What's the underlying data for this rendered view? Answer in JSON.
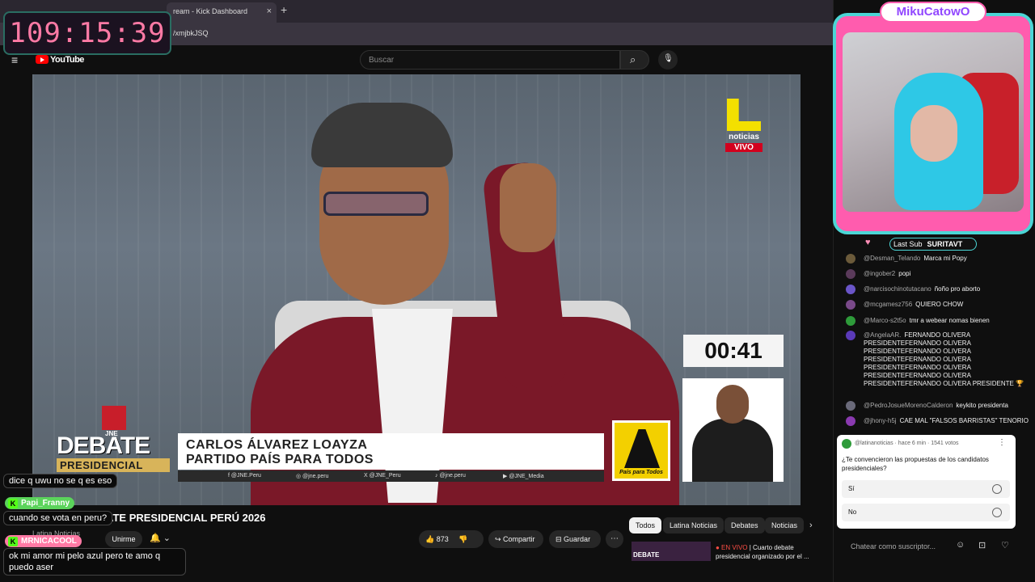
{
  "browser": {
    "tab_title": "ream - Kick Dashboard",
    "tab_close": "×",
    "new_tab": "+",
    "url": "/xmjbkJSQ"
  },
  "stream_timer": "109:15:39",
  "youtube": {
    "menu_icon": "≡",
    "logo_text": "YouTube",
    "search_placeholder": "Buscar",
    "search_icon": "⌕",
    "mic_icon": "🎙"
  },
  "video": {
    "broadcaster_word": "noticias",
    "live_badge": "VIVO",
    "countdown": "00:41",
    "jne_label": "JNE",
    "debate_word": "DEBATE",
    "debate_sub": "PRESIDENCIAL",
    "candidate_name": "CARLOS ÁLVAREZ LOAYZA",
    "party_name": "PARTIDO PAÍS PARA TODOS",
    "party_logo_text": "País para Todos",
    "socials": [
      "f  @JNE.Peru",
      "◎  @jne.peru",
      "X  @JNE_Peru",
      "♪  @jne.peru",
      "▶  @JNE_Media"
    ],
    "fullscreen_icon": "⛶"
  },
  "below_video": {
    "title": "EN VIVO | DEBATE PRESIDENCIAL PERÚ 2026",
    "channel": "Latina Noticias",
    "subscribe": "Unirme",
    "bell_icon": "🔔 ⌄",
    "likes": "873",
    "share": "Compartir",
    "save": "Guardar",
    "more": "⋯"
  },
  "chips": [
    "Todos",
    "Latina Noticias",
    "Debates",
    "Noticias"
  ],
  "chip_next": "›",
  "recommendation": {
    "thumb_text": "DEBATE",
    "live_label": "● EN VIVO",
    "title": "| Cuarto debate presidencial organizado por el ..."
  },
  "overlay_chat": [
    {
      "text": "dice q uwu no se q es eso"
    },
    {
      "user": "Papi_Franny"
    },
    {
      "text": "cuando se vota en peru?"
    },
    {
      "user": "MRNICACOOL"
    },
    {
      "text": "ok mi amor mi pelo azul pero te amo q puedo aser"
    }
  ],
  "streamer": {
    "name": "MikuCatowO",
    "last_sub_label": "Last Sub",
    "last_sub_name": "SURITAVT",
    "heart_icon": "♥"
  },
  "chat": [
    {
      "user": "@Desman_Telando",
      "msg": "Marca mi Popy",
      "color": "#6b5a3a"
    },
    {
      "user": "@ingober2",
      "msg": "popi",
      "color": "#5a3a5a"
    },
    {
      "user": "@narcisochinotutacano",
      "msg": "ñoño pro aborto",
      "color": "#6a55c8"
    },
    {
      "user": "@mcgamesz756",
      "msg": "QUIERO CHOW",
      "color": "#7a4a8a"
    },
    {
      "user": "@Marco-s2t5o",
      "msg": "tmr a webear nomas bienen",
      "color": "#2e9b3a"
    },
    {
      "user": "@AngelaAR.",
      "msg": "FERNANDO OLIVERA PRESIDENTEFERNANDO OLIVERA PRESIDENTEFERNANDO OLIVERA PRESIDENTEFERNANDO OLIVERA PRESIDENTEFERNANDO OLIVERA PRESIDENTEFERNANDO OLIVERA PRESIDENTEFERNANDO OLIVERA PRESIDENTE 🏆",
      "color": "#5a3ab8"
    },
    {
      "user": "@PedroJosueMorenoCalderon",
      "msg": "keykito presidenta",
      "color": "#6a6a7a"
    },
    {
      "user": "@jhony-h5j",
      "msg": "CAE MAL \"FALSOS BARRISTAS\" TENORIO",
      "color": "#8a3ab0"
    }
  ],
  "poll": {
    "header": "@latinanoticias · hace 6 min · 1541 votos",
    "dots": "⋮",
    "question": "¿Te convencieron las propuestas de los candidatos presidenciales?",
    "options": [
      "Sí",
      "No"
    ]
  },
  "chat_input_placeholder": "Chatear como suscriptor...",
  "chat_icons": [
    "☺",
    "⊡",
    "♡"
  ]
}
